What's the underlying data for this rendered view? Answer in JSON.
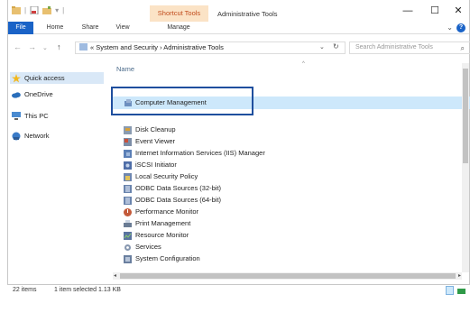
{
  "titlebar": {
    "qat_separator": "|",
    "qat_dropdown": "▾",
    "context_tab": "Shortcut Tools",
    "title": "Administrative Tools",
    "minimize": "—",
    "maximize": "☐",
    "close": "✕"
  },
  "ribbon": {
    "tabs": [
      "File",
      "Home",
      "Share",
      "View",
      "Manage"
    ],
    "collapse": "⌄",
    "help": "?"
  },
  "addressbar": {
    "back": "←",
    "forward": "→",
    "recent": "⌄",
    "up": "↑",
    "path_prefix": "«",
    "path": "System and Security  ›  Administrative Tools",
    "dropdown": "⌄",
    "refresh": "↻",
    "search_placeholder": "Search Administrative Tools",
    "search_icon": "⌕"
  },
  "navpane": {
    "items": [
      {
        "label": "Quick access",
        "icon": "star-icon",
        "color": "#f2b81f"
      },
      {
        "label": "OneDrive",
        "icon": "cloud-icon",
        "color": "#2a6ebb"
      },
      {
        "label": "This PC",
        "icon": "computer-icon",
        "color": "#4a8bd0"
      },
      {
        "label": "Network",
        "icon": "network-icon",
        "color": "#3a7bc8"
      }
    ]
  },
  "content": {
    "column_header": "Name",
    "sort_indicator": "^",
    "selected_item": "Computer Management",
    "items": [
      "Disk Cleanup",
      "Event Viewer",
      "Internet Information Services (IIS) Manager",
      "iSCSI Initiator",
      "Local Security Policy",
      "ODBC Data Sources (32-bit)",
      "ODBC Data Sources (64-bit)",
      "Performance Monitor",
      "Print Management",
      "Resource Monitor",
      "Services",
      "System Configuration"
    ]
  },
  "statusbar": {
    "item_count": "22 items",
    "selection": "1 item selected  1.13 KB"
  },
  "colors": {
    "accent": "#1a63c7",
    "selection": "#cde8fb",
    "highlight_border": "#1f4f9e",
    "context_tab_bg": "#fbe3c6"
  }
}
